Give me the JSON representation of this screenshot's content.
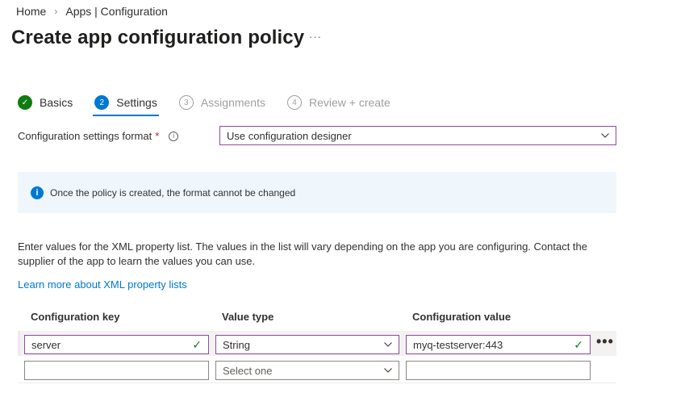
{
  "breadcrumb": {
    "home": "Home",
    "section": "Apps | Configuration"
  },
  "page": {
    "title": "Create app configuration policy",
    "more": "···"
  },
  "steps": [
    {
      "number": "✓",
      "label": "Basics",
      "state": "done"
    },
    {
      "number": "2",
      "label": "Settings",
      "state": "active"
    },
    {
      "number": "3",
      "label": "Assignments",
      "state": "pending"
    },
    {
      "number": "4",
      "label": "Review + create",
      "state": "pending"
    }
  ],
  "format": {
    "label": "Configuration settings format",
    "required": "*",
    "info": "i",
    "value": "Use configuration designer"
  },
  "banner": {
    "icon": "i",
    "text": "Once the policy is created, the format cannot be changed"
  },
  "description": "Enter values for the XML property list. The values in the list will vary depending on the app you are configuring. Contact the supplier of the app to learn the values you can use.",
  "learn_more": "Learn more about XML property lists",
  "table": {
    "headers": {
      "key": "Configuration key",
      "type": "Value type",
      "value": "Configuration value"
    },
    "rows": [
      {
        "key": "server",
        "type": "String",
        "value": "myq-testserver:443"
      },
      {
        "key": "",
        "type_placeholder": "Select one",
        "value": ""
      }
    ],
    "row_menu": "•••"
  },
  "colors": {
    "accent": "#0078d4",
    "success": "#107c10",
    "focus_border": "#8b4d99",
    "banner_bg": "#eff6fc"
  }
}
